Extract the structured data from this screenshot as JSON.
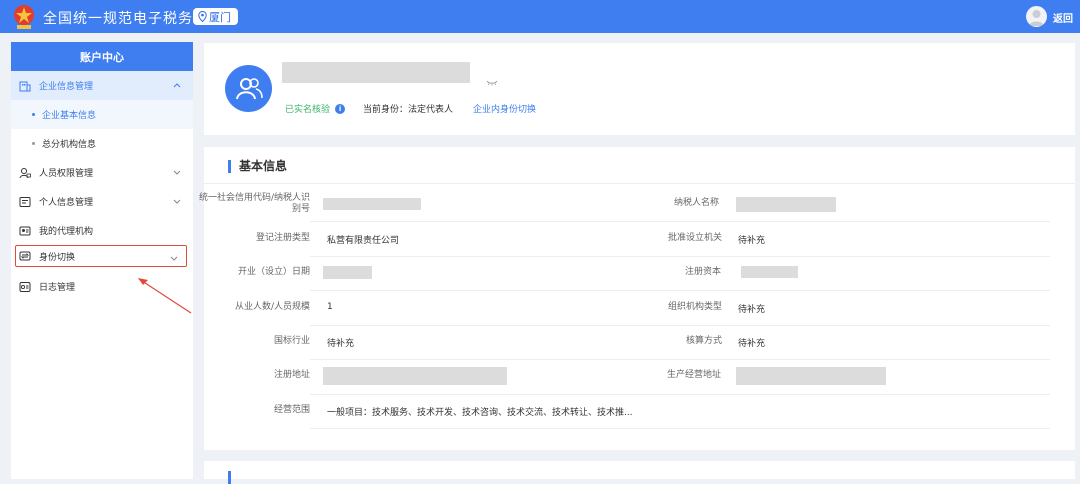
{
  "header": {
    "title": "全国统一规范电子税务局",
    "city": "厦门",
    "back_label": "返回"
  },
  "sidebar": {
    "title": "账户中心",
    "items": [
      {
        "label": "企业信息管理",
        "icon": "building-icon"
      },
      {
        "label": "企业基本信息"
      },
      {
        "label": "总分机构信息"
      },
      {
        "label": "人员权限管理",
        "icon": "user-lock-icon"
      },
      {
        "label": "个人信息管理",
        "icon": "profile-card-icon"
      },
      {
        "label": "我的代理机构",
        "icon": "agency-icon"
      },
      {
        "label": "身份切换",
        "icon": "switch-icon"
      },
      {
        "label": "日志管理",
        "icon": "log-icon"
      }
    ]
  },
  "profile": {
    "verified_label": "已实名核验",
    "identity_label": "当前身份：法定代表人",
    "switch_label": "企业内身份切换"
  },
  "basic_info": {
    "title": "基本信息",
    "fields": [
      {
        "label": "统一社会信用代码/纳税人识别号",
        "value": ""
      },
      {
        "label": "纳税人名称",
        "value": ""
      },
      {
        "label": "登记注册类型",
        "value": "私营有限责任公司"
      },
      {
        "label": "批准设立机关",
        "value": "待补充"
      },
      {
        "label": "开业（设立）日期",
        "value": ""
      },
      {
        "label": "注册资本",
        "value": ""
      },
      {
        "label": "从业人数/人员规模",
        "value": "1"
      },
      {
        "label": "组织机构类型",
        "value": "待补充"
      },
      {
        "label": "国标行业",
        "value": "待补充"
      },
      {
        "label": "核算方式",
        "value": "待补充"
      },
      {
        "label": "注册地址",
        "value": ""
      },
      {
        "label": "生产经营地址",
        "value": ""
      },
      {
        "label": "经营范围",
        "value": "一般项目：技术服务、技术开发、技术咨询、技术交流、技术转让、技术推..."
      }
    ]
  },
  "colors": {
    "primary": "#3f7ef0",
    "verified": "#3bb36a",
    "annotation": "#e04b3c"
  }
}
